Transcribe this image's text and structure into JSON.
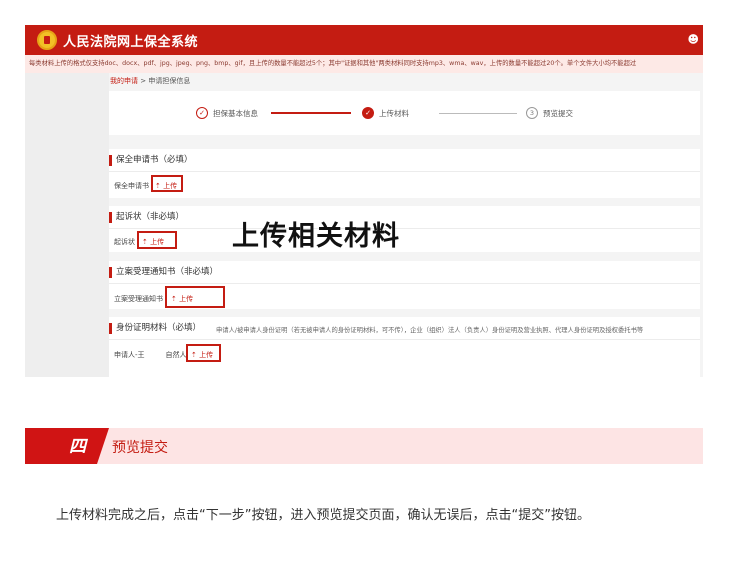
{
  "app": {
    "title": "人民法院网上保全系统",
    "user_icon": "user-icon"
  },
  "notice": "每类材料上传的格式仅支持doc、docx、pdf、jpg、jpeg、png、bmp、gif，且上传的数量不能超过5个；其中\"证据和其他\"两类材料同时支持mp3、wma、wav，上传的数量不能超过20个。单个文件大小均不能超过",
  "breadcrumb": {
    "home": "我的申请",
    "separator": ">",
    "current": "申请担保信息"
  },
  "steps": [
    {
      "icon": "✓",
      "label": "担保基本信息"
    },
    {
      "icon": "✓",
      "label": "上传材料"
    },
    {
      "icon": "3",
      "label": "预览提交"
    }
  ],
  "sections": {
    "application": {
      "title": "保全申请书（必填）",
      "field": "保全申请书",
      "upload": "⇡ 上传"
    },
    "complaint": {
      "title": "起诉状（非必填）",
      "field": "起诉状",
      "upload": "⇡ 上传"
    },
    "acceptance": {
      "title": "立案受理通知书（非必填）",
      "field": "立案受理通知书",
      "upload": "⇡ 上传"
    },
    "identity": {
      "title": "身份证明材料（必填）",
      "description": "申请人/被申请人身份证明（若无被申请人的身份证明材料，可不传），企业（组织）法人（负责人）身份证明及营业执照、代理人身份证明及授权委托书等",
      "field": "申请人-王　　　自然人",
      "upload": "⇡ 上传"
    }
  },
  "overlay_caption": "上传相关材料",
  "banner": {
    "number": "四",
    "title": "预览提交"
  },
  "body_text": "上传材料完成之后，点击“下一步”按钮，进入预览提交页面，确认无误后，点击“提交”按钮。",
  "colors": {
    "brand_red": "#c41c12",
    "banner_bg": "#fde4e4",
    "notice_bg": "#fde9e6"
  }
}
